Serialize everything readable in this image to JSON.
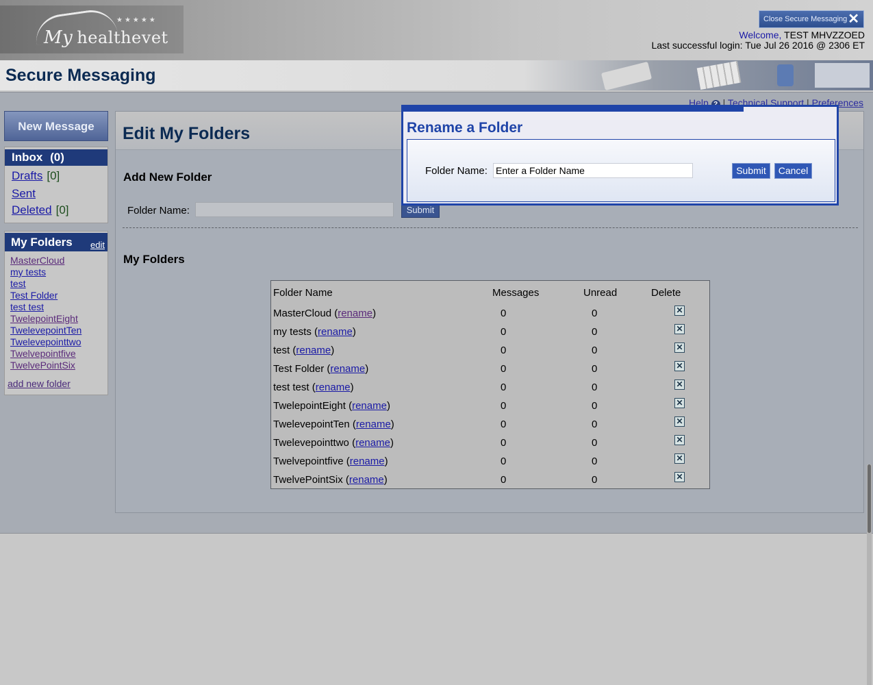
{
  "header": {
    "logo_text": "My healthevet",
    "logo_my": "My",
    "logo_rest": "healthevet",
    "close_button": "Close Secure Messaging",
    "welcome_prefix": "Welcome,",
    "user_name": "TEST MHVZZOED",
    "last_login": "Last successful login: Tue Jul 26 2016 @ 2306 ET"
  },
  "section": {
    "title": "Secure Messaging"
  },
  "help_links": {
    "help": "Help",
    "technical_support": "Technical Support",
    "preferences": "Preferences"
  },
  "sidebar": {
    "new_message": "New Message",
    "inbox": {
      "label": "Inbox",
      "count": "(0)"
    },
    "drafts": {
      "label": "Drafts",
      "count": "[0]"
    },
    "sent": {
      "label": "Sent"
    },
    "deleted": {
      "label": "Deleted",
      "count": "[0]"
    },
    "my_folders_title": "My Folders",
    "edit_link": "edit",
    "folders": [
      "MasterCloud",
      "my tests",
      "test",
      "Test Folder",
      "test test",
      "TwelepointEight",
      "TwelevepointTen",
      "Twelevepointtwo",
      "Twelvepointfive",
      "TwelvePointSix"
    ],
    "add_new_folder": "add new folder"
  },
  "main": {
    "page_title": "Edit My Folders",
    "add_new_folder_title": "Add New Folder",
    "folder_name_label": "Folder Name:",
    "submit": "Submit",
    "my_folders_title": "My Folders",
    "table": {
      "headers": [
        "Folder Name",
        "Messages",
        "Unread",
        "Delete"
      ],
      "rename_link": "rename",
      "rows": [
        {
          "name": "MasterCloud",
          "messages": "0",
          "unread": "0"
        },
        {
          "name": "my tests",
          "messages": "0",
          "unread": "0"
        },
        {
          "name": "test",
          "messages": "0",
          "unread": "0"
        },
        {
          "name": "Test Folder",
          "messages": "0",
          "unread": "0"
        },
        {
          "name": "test test",
          "messages": "0",
          "unread": "0"
        },
        {
          "name": "TwelepointEight",
          "messages": "0",
          "unread": "0"
        },
        {
          "name": "TwelevepointTen",
          "messages": "0",
          "unread": "0"
        },
        {
          "name": "Twelevepointtwo",
          "messages": "0",
          "unread": "0"
        },
        {
          "name": "Twelvepointfive",
          "messages": "0",
          "unread": "0"
        },
        {
          "name": "TwelvePointSix",
          "messages": "0",
          "unread": "0"
        }
      ]
    }
  },
  "modal": {
    "title": "Rename a Folder",
    "folder_name_label": "Folder Name:",
    "input_value": "Enter a Folder Name",
    "submit": "Submit",
    "cancel": "Cancel"
  },
  "colors": {
    "accent": "#1f44a8",
    "nav_dark": "#1f3a7a",
    "page_title": "#0b2a52"
  }
}
